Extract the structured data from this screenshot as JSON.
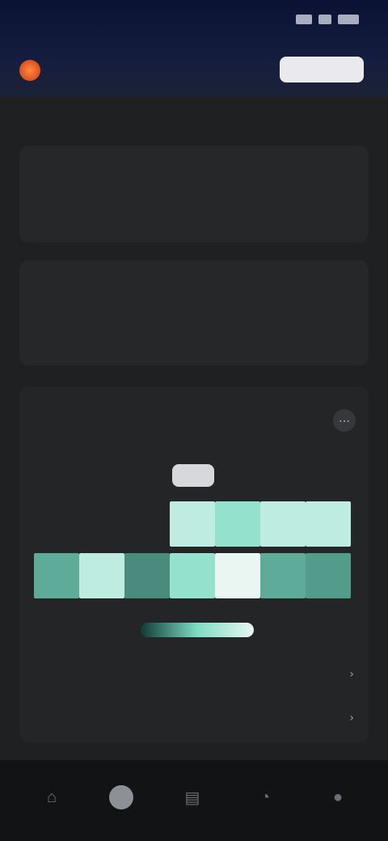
{
  "status": {
    "time": ""
  },
  "header": {
    "app_title": "",
    "action_label": ""
  },
  "summary": {
    "left": "",
    "center": "",
    "right": ""
  },
  "metrics_a": {
    "section": "",
    "items": [
      {
        "label": "",
        "value": "",
        "color": "#5fc24a"
      },
      {
        "label": "",
        "value": "",
        "color": "#ef7a2c"
      },
      {
        "label": "",
        "value": "",
        "color": "#d8a029"
      }
    ]
  },
  "metrics_b": {
    "section": "",
    "items": [
      {
        "label": "",
        "value": "",
        "color": "#ef7a2c"
      },
      {
        "label": "",
        "value": "",
        "color": "#ef7a2c"
      }
    ]
  },
  "schedule": {
    "title": "",
    "days": [
      "",
      "",
      "",
      "",
      "",
      "",
      ""
    ],
    "active_day_index": 3,
    "heatmap": {
      "upper_row": [
        null,
        null,
        null,
        0.8,
        0.6,
        0.8,
        0.8
      ],
      "lower_row": [
        0.35,
        0.8,
        0.25,
        0.6,
        1.0,
        0.35,
        0.3
      ]
    },
    "legend_low": "",
    "legend_high": "",
    "rows": [
      {
        "label": "",
        "value": ""
      },
      {
        "label": "",
        "value": ""
      }
    ]
  },
  "nav": {
    "active_index": 1
  },
  "colors": {
    "accent": "#ef7a2c",
    "success": "#5fc24a",
    "heat_low": "#123a35",
    "heat_high": "#e9f6f2"
  }
}
